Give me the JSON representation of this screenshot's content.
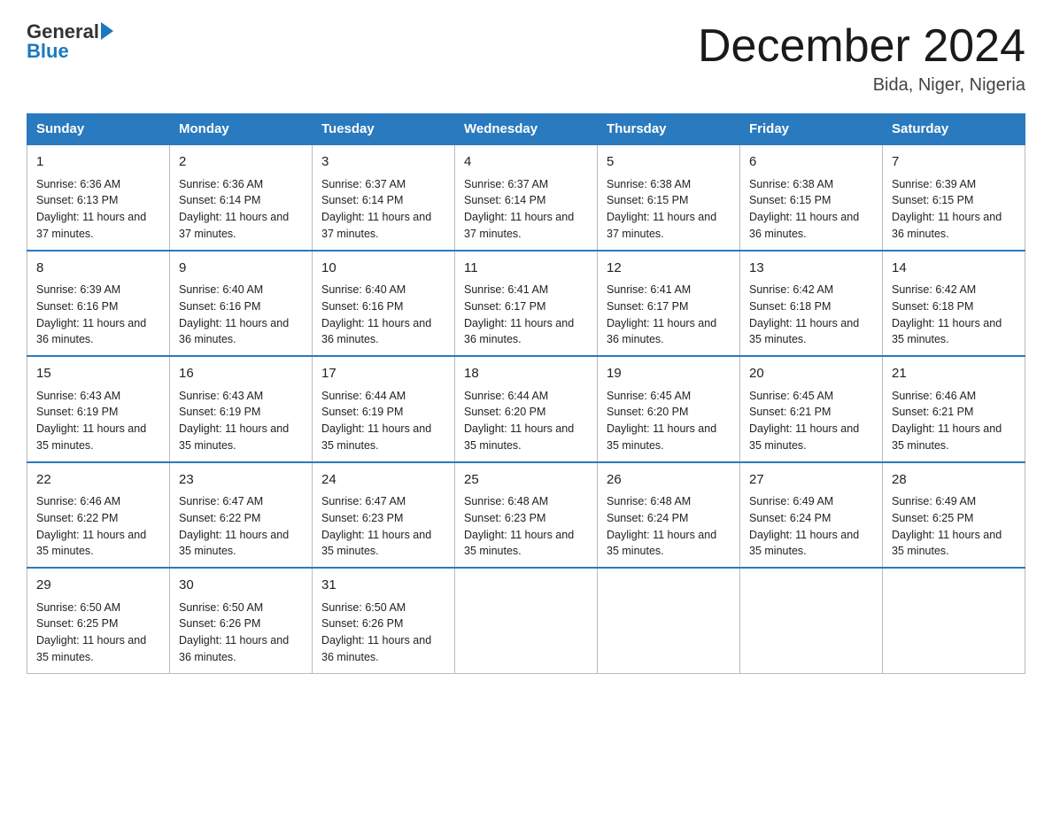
{
  "header": {
    "logo_text_general": "General",
    "logo_text_blue": "Blue",
    "title": "December 2024",
    "subtitle": "Bida, Niger, Nigeria"
  },
  "days_of_week": [
    "Sunday",
    "Monday",
    "Tuesday",
    "Wednesday",
    "Thursday",
    "Friday",
    "Saturday"
  ],
  "weeks": [
    [
      {
        "day": "1",
        "sunrise": "6:36 AM",
        "sunset": "6:13 PM",
        "daylight": "11 hours and 37 minutes."
      },
      {
        "day": "2",
        "sunrise": "6:36 AM",
        "sunset": "6:14 PM",
        "daylight": "11 hours and 37 minutes."
      },
      {
        "day": "3",
        "sunrise": "6:37 AM",
        "sunset": "6:14 PM",
        "daylight": "11 hours and 37 minutes."
      },
      {
        "day": "4",
        "sunrise": "6:37 AM",
        "sunset": "6:14 PM",
        "daylight": "11 hours and 37 minutes."
      },
      {
        "day": "5",
        "sunrise": "6:38 AM",
        "sunset": "6:15 PM",
        "daylight": "11 hours and 37 minutes."
      },
      {
        "day": "6",
        "sunrise": "6:38 AM",
        "sunset": "6:15 PM",
        "daylight": "11 hours and 36 minutes."
      },
      {
        "day": "7",
        "sunrise": "6:39 AM",
        "sunset": "6:15 PM",
        "daylight": "11 hours and 36 minutes."
      }
    ],
    [
      {
        "day": "8",
        "sunrise": "6:39 AM",
        "sunset": "6:16 PM",
        "daylight": "11 hours and 36 minutes."
      },
      {
        "day": "9",
        "sunrise": "6:40 AM",
        "sunset": "6:16 PM",
        "daylight": "11 hours and 36 minutes."
      },
      {
        "day": "10",
        "sunrise": "6:40 AM",
        "sunset": "6:16 PM",
        "daylight": "11 hours and 36 minutes."
      },
      {
        "day": "11",
        "sunrise": "6:41 AM",
        "sunset": "6:17 PM",
        "daylight": "11 hours and 36 minutes."
      },
      {
        "day": "12",
        "sunrise": "6:41 AM",
        "sunset": "6:17 PM",
        "daylight": "11 hours and 36 minutes."
      },
      {
        "day": "13",
        "sunrise": "6:42 AM",
        "sunset": "6:18 PM",
        "daylight": "11 hours and 35 minutes."
      },
      {
        "day": "14",
        "sunrise": "6:42 AM",
        "sunset": "6:18 PM",
        "daylight": "11 hours and 35 minutes."
      }
    ],
    [
      {
        "day": "15",
        "sunrise": "6:43 AM",
        "sunset": "6:19 PM",
        "daylight": "11 hours and 35 minutes."
      },
      {
        "day": "16",
        "sunrise": "6:43 AM",
        "sunset": "6:19 PM",
        "daylight": "11 hours and 35 minutes."
      },
      {
        "day": "17",
        "sunrise": "6:44 AM",
        "sunset": "6:19 PM",
        "daylight": "11 hours and 35 minutes."
      },
      {
        "day": "18",
        "sunrise": "6:44 AM",
        "sunset": "6:20 PM",
        "daylight": "11 hours and 35 minutes."
      },
      {
        "day": "19",
        "sunrise": "6:45 AM",
        "sunset": "6:20 PM",
        "daylight": "11 hours and 35 minutes."
      },
      {
        "day": "20",
        "sunrise": "6:45 AM",
        "sunset": "6:21 PM",
        "daylight": "11 hours and 35 minutes."
      },
      {
        "day": "21",
        "sunrise": "6:46 AM",
        "sunset": "6:21 PM",
        "daylight": "11 hours and 35 minutes."
      }
    ],
    [
      {
        "day": "22",
        "sunrise": "6:46 AM",
        "sunset": "6:22 PM",
        "daylight": "11 hours and 35 minutes."
      },
      {
        "day": "23",
        "sunrise": "6:47 AM",
        "sunset": "6:22 PM",
        "daylight": "11 hours and 35 minutes."
      },
      {
        "day": "24",
        "sunrise": "6:47 AM",
        "sunset": "6:23 PM",
        "daylight": "11 hours and 35 minutes."
      },
      {
        "day": "25",
        "sunrise": "6:48 AM",
        "sunset": "6:23 PM",
        "daylight": "11 hours and 35 minutes."
      },
      {
        "day": "26",
        "sunrise": "6:48 AM",
        "sunset": "6:24 PM",
        "daylight": "11 hours and 35 minutes."
      },
      {
        "day": "27",
        "sunrise": "6:49 AM",
        "sunset": "6:24 PM",
        "daylight": "11 hours and 35 minutes."
      },
      {
        "day": "28",
        "sunrise": "6:49 AM",
        "sunset": "6:25 PM",
        "daylight": "11 hours and 35 minutes."
      }
    ],
    [
      {
        "day": "29",
        "sunrise": "6:50 AM",
        "sunset": "6:25 PM",
        "daylight": "11 hours and 35 minutes."
      },
      {
        "day": "30",
        "sunrise": "6:50 AM",
        "sunset": "6:26 PM",
        "daylight": "11 hours and 36 minutes."
      },
      {
        "day": "31",
        "sunrise": "6:50 AM",
        "sunset": "6:26 PM",
        "daylight": "11 hours and 36 minutes."
      },
      null,
      null,
      null,
      null
    ]
  ],
  "labels": {
    "sunrise": "Sunrise:",
    "sunset": "Sunset:",
    "daylight": "Daylight:"
  }
}
